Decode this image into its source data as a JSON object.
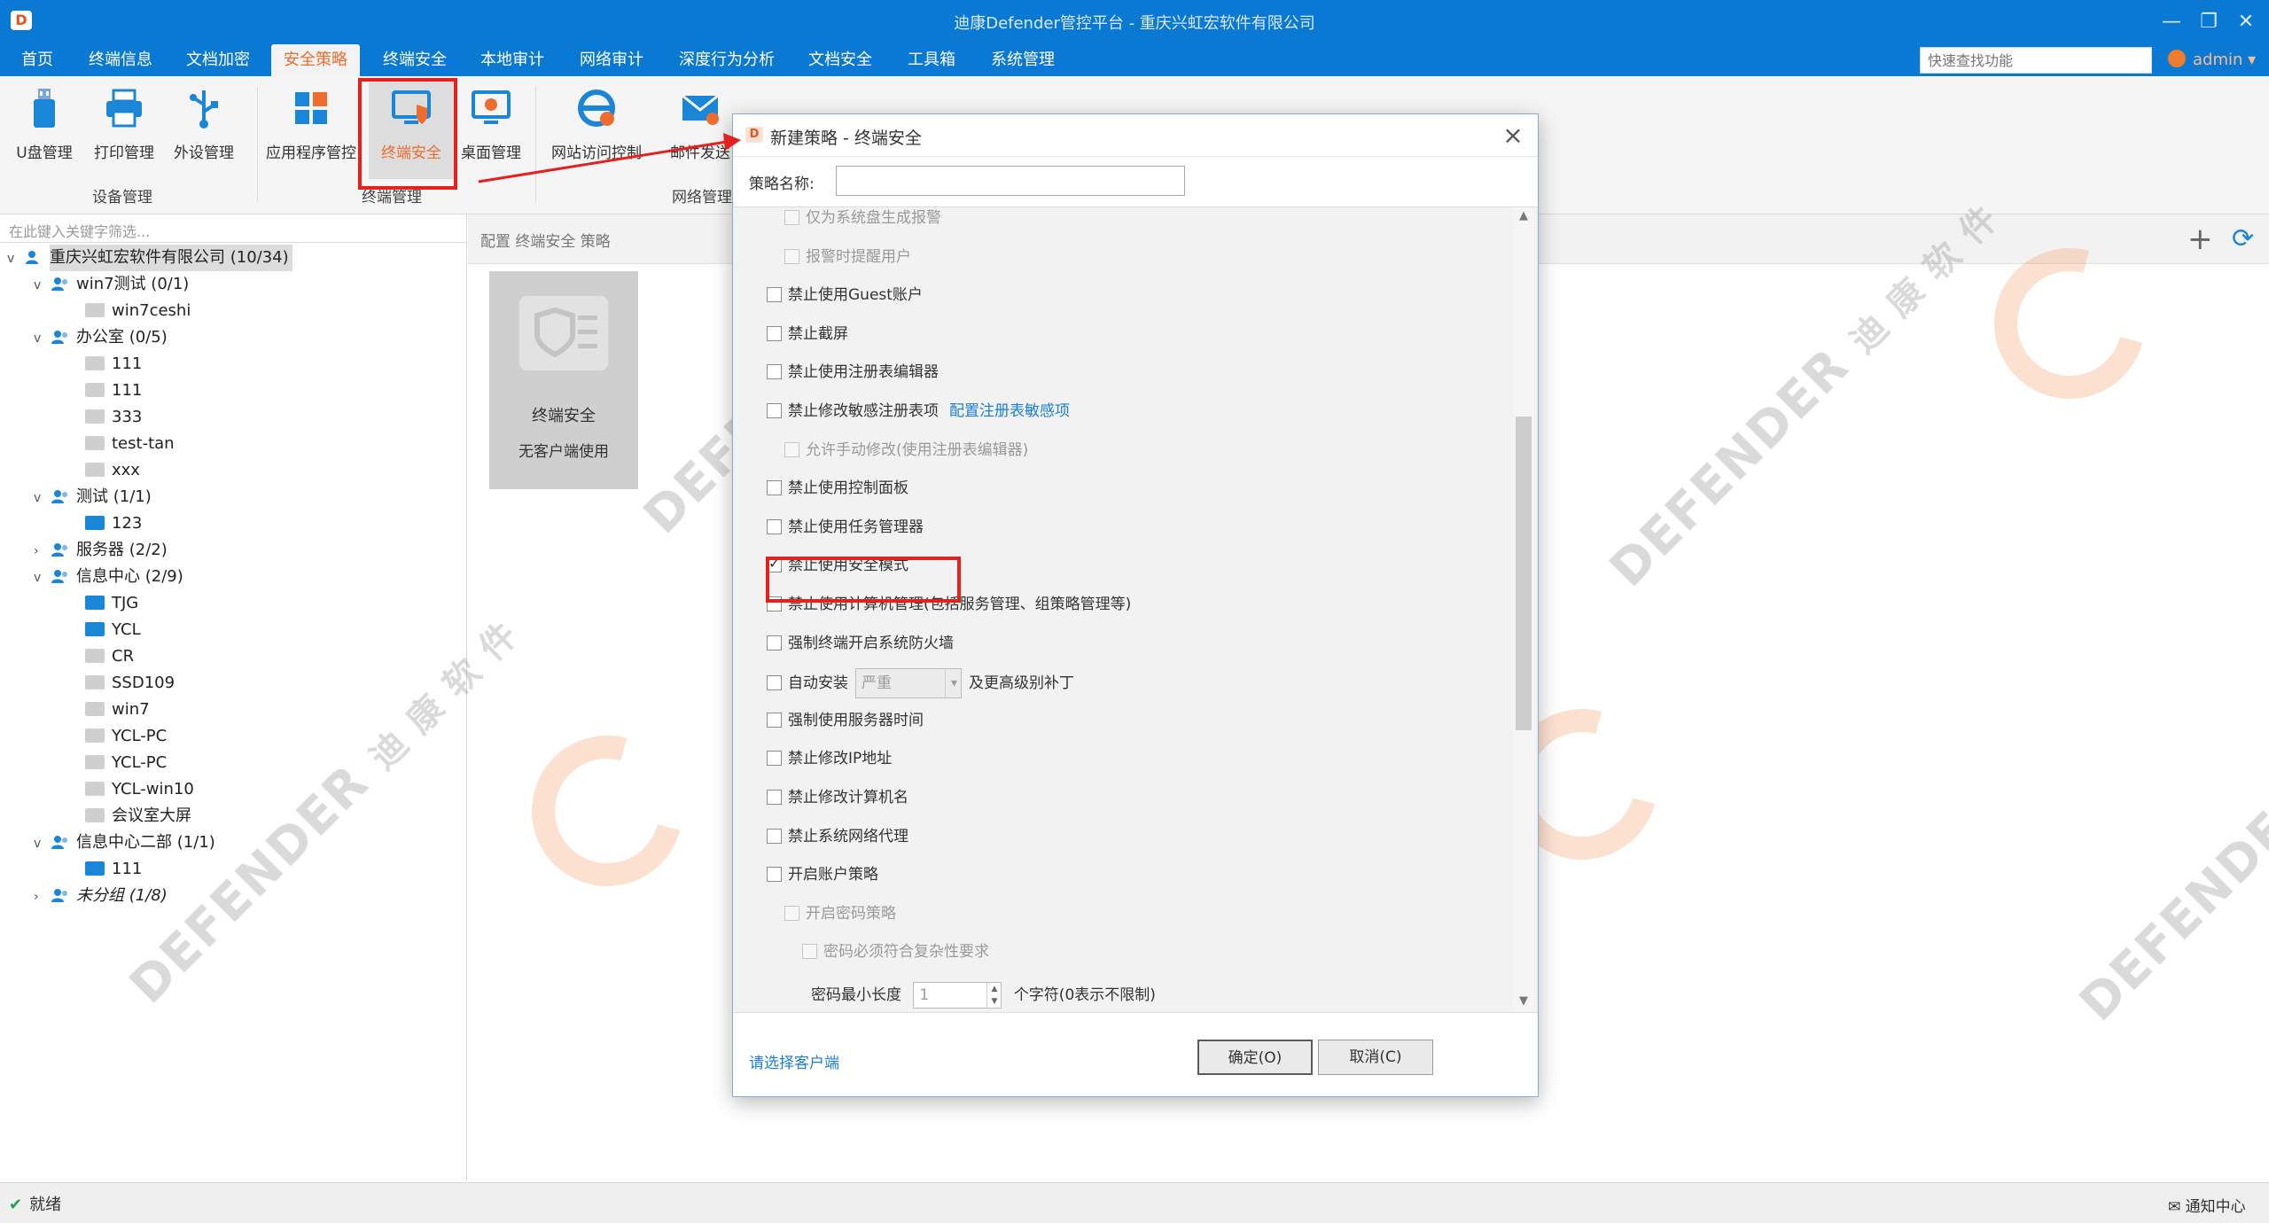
{
  "window": {
    "title": "迪康Defender管控平台 - 重庆兴虹宏软件有限公司",
    "controls": [
      "—",
      "❐",
      "✕"
    ]
  },
  "menu": {
    "tabs": [
      "首页",
      "终端信息",
      "文档加密",
      "安全策略",
      "终端安全",
      "本地审计",
      "网络审计",
      "深度行为分析",
      "文档安全",
      "工具箱",
      "系统管理"
    ],
    "active": "安全策略",
    "quick_search_placeholder": "快速查找功能",
    "user": "admin ▾"
  },
  "ribbon": {
    "buttons": [
      "U盘管理",
      "打印管理",
      "外设管理",
      "应用程序管控",
      "终端安全",
      "桌面管理",
      "网站访问控制",
      "邮件发送"
    ],
    "groups": [
      "设备管理",
      "终端管理",
      "网络管理"
    ],
    "selected": "终端安全"
  },
  "tree": {
    "filter_placeholder": "在此键入关键字筛选...",
    "root": "重庆兴虹宏软件有限公司 (10/34)",
    "items": [
      {
        "label": "win7测试 (0/1)",
        "type": "group",
        "expand": "v"
      },
      {
        "label": "win7ceshi",
        "type": "pc-off"
      },
      {
        "label": "办公室 (0/5)",
        "type": "group",
        "expand": "v"
      },
      {
        "label": "111",
        "type": "pc-off"
      },
      {
        "label": "111",
        "type": "pc-off"
      },
      {
        "label": "333",
        "type": "pc-off"
      },
      {
        "label": "test-tan",
        "type": "pc-off"
      },
      {
        "label": "xxx",
        "type": "pc-off"
      },
      {
        "label": "测试 (1/1)",
        "type": "group",
        "expand": "v"
      },
      {
        "label": "123",
        "type": "pc-on"
      },
      {
        "label": "服务器 (2/2)",
        "type": "group",
        "expand": ">"
      },
      {
        "label": "信息中心 (2/9)",
        "type": "group",
        "expand": "v"
      },
      {
        "label": "TJG",
        "type": "pc-on"
      },
      {
        "label": "YCL",
        "type": "pc-on"
      },
      {
        "label": "CR",
        "type": "pc-off"
      },
      {
        "label": "SSD109",
        "type": "pc-off"
      },
      {
        "label": "win7",
        "type": "pc-off"
      },
      {
        "label": "YCL-PC",
        "type": "pc-off"
      },
      {
        "label": "YCL-PC",
        "type": "pc-off"
      },
      {
        "label": "YCL-win10",
        "type": "pc-off"
      },
      {
        "label": "会议室大屏",
        "type": "pc-off"
      },
      {
        "label": "信息中心二部 (1/1)",
        "type": "group",
        "expand": "v"
      },
      {
        "label": "111",
        "type": "pc-on"
      },
      {
        "label": "未分组 (1/8)",
        "type": "group",
        "expand": ">"
      }
    ]
  },
  "center": {
    "header": "配置 终端安全 策略",
    "card": {
      "title": "终端安全",
      "subtitle": "无客户端使用"
    }
  },
  "dialog": {
    "title": "新建策略 - 终端安全",
    "name_label": "策略名称:",
    "name_value": "",
    "options": [
      {
        "label": "仅为系统盘生成报警",
        "checked": false,
        "disabled": true,
        "indent": 1
      },
      {
        "label": "报警时提醒用户",
        "checked": false,
        "disabled": true,
        "indent": 1
      },
      {
        "label": "禁止使用Guest账户",
        "checked": false,
        "disabled": false,
        "indent": 0
      },
      {
        "label": "禁止截屏",
        "checked": false,
        "disabled": false,
        "indent": 0
      },
      {
        "label": "禁止使用注册表编辑器",
        "checked": false,
        "disabled": false,
        "indent": 0
      },
      {
        "label": "禁止修改敏感注册表项",
        "checked": false,
        "disabled": false,
        "indent": 0,
        "link": "配置注册表敏感项"
      },
      {
        "label": "允许手动修改(使用注册表编辑器)",
        "checked": false,
        "disabled": true,
        "indent": 1
      },
      {
        "label": "禁止使用控制面板",
        "checked": false,
        "disabled": false,
        "indent": 0
      },
      {
        "label": "禁止使用任务管理器",
        "checked": false,
        "disabled": false,
        "indent": 0
      },
      {
        "label": "禁止使用安全模式",
        "checked": true,
        "disabled": false,
        "indent": 0
      },
      {
        "label": "禁止使用计算机管理(包括服务管理、组策略管理等)",
        "checked": false,
        "disabled": false,
        "indent": 0
      },
      {
        "label": "强制终端开启系统防火墙",
        "checked": false,
        "disabled": false,
        "indent": 0
      },
      {
        "label": "自动安装",
        "checked": false,
        "disabled": false,
        "indent": 0,
        "select": "严重",
        "suffix": "及更高级别补丁"
      },
      {
        "label": "强制使用服务器时间",
        "checked": false,
        "disabled": false,
        "indent": 0
      },
      {
        "label": "禁止修改IP地址",
        "checked": false,
        "disabled": false,
        "indent": 0
      },
      {
        "label": "禁止修改计算机名",
        "checked": false,
        "disabled": false,
        "indent": 0
      },
      {
        "label": "禁止系统网络代理",
        "checked": false,
        "disabled": false,
        "indent": 0
      },
      {
        "label": "开启账户策略",
        "checked": false,
        "disabled": false,
        "indent": 0
      },
      {
        "label": "开启密码策略",
        "checked": false,
        "disabled": true,
        "indent": 1
      },
      {
        "label": "密码必须符合复杂性要求",
        "checked": false,
        "disabled": true,
        "indent": 2
      }
    ],
    "min_length_label": "密码最小长度",
    "min_length_value": "1",
    "min_length_suffix": "个字符(0表示不限制)",
    "choose_client": "请选择客户端",
    "ok": "确定(O)",
    "cancel": "取消(C)"
  },
  "statusbar": {
    "status": "就绪",
    "notify": "通知中心"
  },
  "watermark": {
    "brand": "DEFENDER",
    "cn": "迪 康 软 件"
  },
  "colors": {
    "titlebar": "#0a79d4",
    "accent": "#ef6c2d",
    "highlight_box": "#e4211f",
    "link": "#1a7fd6"
  }
}
